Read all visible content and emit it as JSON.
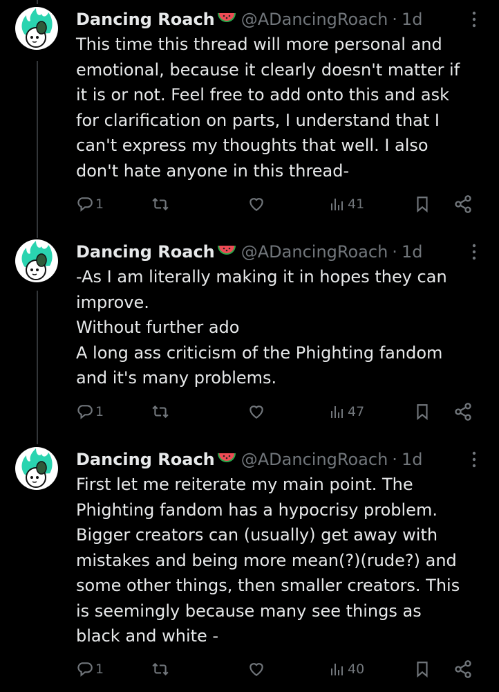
{
  "author": {
    "name": "Dancing Roach",
    "handle": "@ADancingRoach",
    "separator": "·",
    "emoji": "watermelon-icon",
    "colors": {
      "avatar_bg": "#ffffff",
      "flame": "#2ad4b0",
      "grenade": "#2f5a3a"
    }
  },
  "tweets": [
    {
      "time": "1d",
      "text": "This time this thread will more personal and\nemotional, because it clearly doesn't matter if\nit is or not. Feel free to add onto this and ask\nfor clarification on parts, I understand that I\ncan't express my thoughts that well. I also\ndon't hate anyone in this thread-",
      "replies": "1",
      "views": "41"
    },
    {
      "time": "1d",
      "text": "-As I am literally making it in hopes they can\nimprove.\nWithout further ado\nA long ass criticism of the Phighting fandom\nand it's many problems.",
      "replies": "1",
      "views": "47"
    },
    {
      "time": "1d",
      "text": "First let me reiterate my main point. The\nPhighting fandom has a hypocrisy problem.\nBigger creators can (usually) get away with\nmistakes and being more mean(?)(rude?) and\nsome other things, then smaller creators. This\nis seemingly because many see things as\nblack and white -",
      "replies": "1",
      "views": "40"
    }
  ]
}
